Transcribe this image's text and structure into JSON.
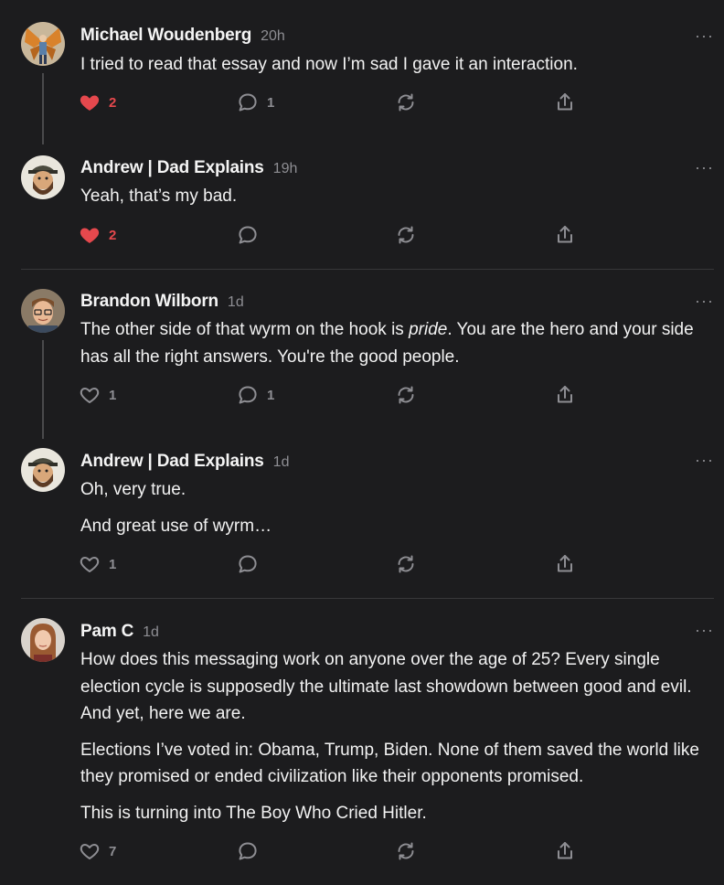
{
  "colors": {
    "background": "#1c1c1e",
    "text": "#f2f2f2",
    "muted": "#8e8e93",
    "liked": "#e5484d",
    "divider": "#38383a"
  },
  "comments": [
    {
      "author": "Michael Woudenberg",
      "time": "20h",
      "paragraphs": [
        "I tried to read that essay and now I’m sad I gave it an interaction."
      ],
      "likes": "2",
      "liked": true,
      "replies": "1",
      "avatar_icon": "butterfly-avatar"
    },
    {
      "author": "Andrew | Dad Explains",
      "time": "19h",
      "paragraphs": [
        "Yeah, that’s my bad."
      ],
      "likes": "2",
      "liked": true,
      "replies": "",
      "avatar_icon": "bearded-cap-avatar"
    },
    {
      "author": "Brandon Wilborn",
      "time": "1d",
      "paragraph_parts": [
        "The other side of that wyrm on the hook is ",
        "pride",
        ". You are the hero and your side has all the right answers. You're the good people."
      ],
      "likes": "1",
      "liked": false,
      "replies": "1",
      "avatar_icon": "glasses-man-avatar"
    },
    {
      "author": "Andrew | Dad Explains",
      "time": "1d",
      "paragraphs": [
        "Oh, very true.",
        "And great use of wyrm…"
      ],
      "likes": "1",
      "liked": false,
      "replies": "",
      "avatar_icon": "bearded-cap-avatar"
    },
    {
      "author": "Pam C",
      "time": "1d",
      "paragraphs": [
        "How does this messaging work on anyone over the age of 25? Every single election cycle is supposedly the ultimate last showdown between good and evil. And yet, here we are.",
        "Elections I’ve voted in: Obama, Trump, Biden. None of them saved the world like they promised or ended civilization like their opponents promised.",
        "This is turning into The Boy Who Cried Hitler."
      ],
      "likes": "7",
      "liked": false,
      "replies": "",
      "avatar_icon": "woman-avatar"
    }
  ],
  "more_glyph": "···"
}
